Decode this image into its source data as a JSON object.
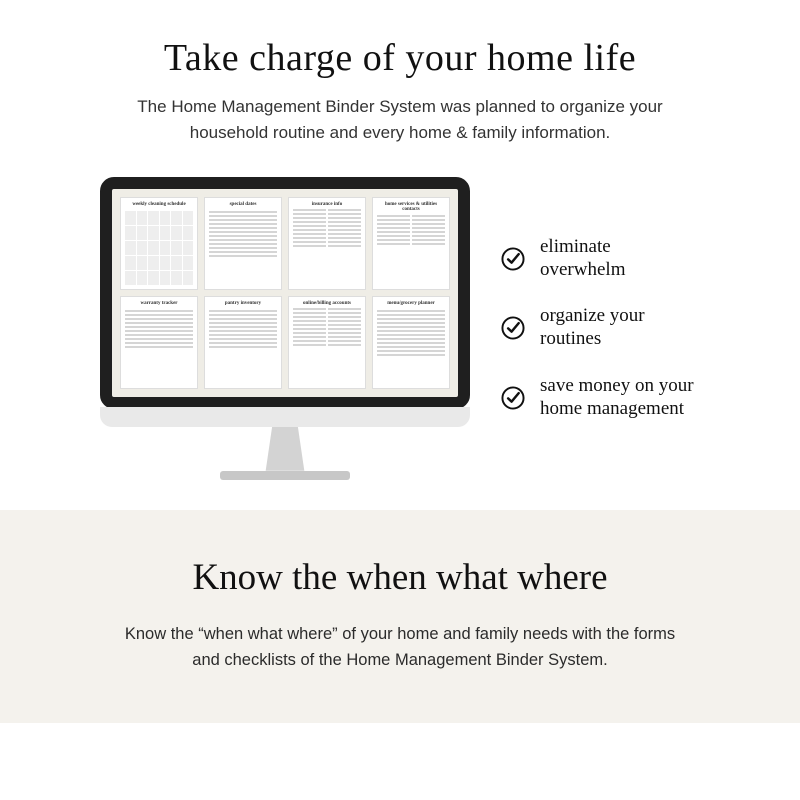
{
  "top": {
    "headline": "Take charge of your home life",
    "subhead": "The Home Management Binder System was planned to organize your household routine and every home & family information."
  },
  "monitor": {
    "pages": [
      "weekly cleaning schedule",
      "special dates",
      "insurance info",
      "home services & utilities contacts",
      "warranty tracker",
      "pantry inventory",
      "online/billing accounts",
      "menu/grocery planner"
    ]
  },
  "benefits": [
    "eliminate overwhelm",
    "organize your routines",
    "save money on your home management"
  ],
  "bottom": {
    "headline": "Know the when what where",
    "subhead": "Know the “when what where” of your home and family needs with the forms and checklists of the Home Management Binder System."
  }
}
